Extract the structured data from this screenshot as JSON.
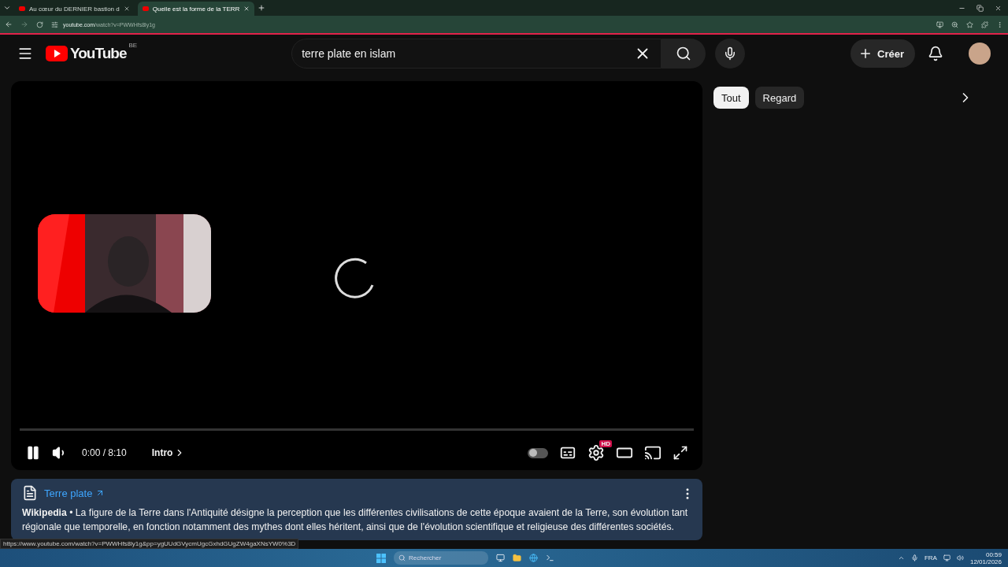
{
  "browser": {
    "tabs": [
      {
        "title": "Au cœur du DERNIER bastion d",
        "selected": false
      },
      {
        "title": "Quelle est la forme de la TERR",
        "selected": true
      }
    ],
    "address": {
      "host": "youtube.com",
      "path": "/watch?v=PWWHfs8ly1g"
    }
  },
  "header": {
    "logo": "YouTube",
    "region": "BE",
    "search": {
      "value": "terre plate en islam"
    },
    "create": "Créer"
  },
  "player": {
    "playing": true,
    "time": "0:00 / 8:10",
    "chapter": "Intro",
    "autoplay": {
      "on": false
    },
    "quality_badge": "HD",
    "progress": {
      "level": 0
    },
    "loading": true
  },
  "chips": [
    {
      "label": "Tout",
      "selected": true
    },
    {
      "label": "Regard",
      "selected": false
    }
  ],
  "info_card": {
    "title": "Terre plate",
    "text": "**Wikipedia** • La figure de la Terre dans l'Antiquité désigne la perception que les différentes civilisations de cette époque avaient de la Terre, son évolution tant régionale que temporelle, en fonction notamment des mythes dont elles héritent, ainsi que de l'évolution scientifique et religieuse des différentes sociétés."
  },
  "status_url": "https://www.youtube.com/watch?v=PWWHfs8ly1g&pp=ygUUdGVycmUgcGxhdGUgZW4gaXNsYW0%3D",
  "taskbar": {
    "search": {
      "placeholder": "Rechercher"
    },
    "language": "FRA",
    "time": "00:59",
    "date": "12/01/2026"
  }
}
